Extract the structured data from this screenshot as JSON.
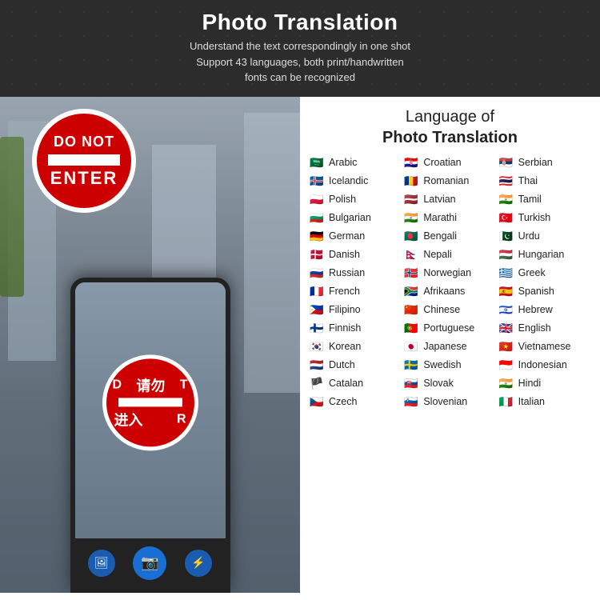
{
  "header": {
    "title": "Photo Translation",
    "subtitle1": "Understand the text correspondingly in one shot",
    "subtitle2": "Support 43 languages, both print/handwritten",
    "subtitle3": "fonts can be recognized"
  },
  "right_panel": {
    "title_line1": "Language of",
    "title_line2": "Photo Translation"
  },
  "languages": [
    {
      "name": "Arabic",
      "flag": "🇸🇦"
    },
    {
      "name": "Croatian",
      "flag": "🇭🇷"
    },
    {
      "name": "Serbian",
      "flag": "🇷🇸"
    },
    {
      "name": "Icelandic",
      "flag": "🇮🇸"
    },
    {
      "name": "Romanian",
      "flag": "🇷🇴"
    },
    {
      "name": "Thai",
      "flag": "🇹🇭"
    },
    {
      "name": "Polish",
      "flag": "🇵🇱"
    },
    {
      "name": "Latvian",
      "flag": "🇱🇻"
    },
    {
      "name": "Tamil",
      "flag": "🇮🇳"
    },
    {
      "name": "Bulgarian",
      "flag": "🇧🇬"
    },
    {
      "name": "Marathi",
      "flag": "🇮🇳"
    },
    {
      "name": "Turkish",
      "flag": "🇹🇷"
    },
    {
      "name": "German",
      "flag": "🇩🇪"
    },
    {
      "name": "Bengali",
      "flag": "🇧🇩"
    },
    {
      "name": "Urdu",
      "flag": "🇵🇰"
    },
    {
      "name": "Danish",
      "flag": "🇩🇰"
    },
    {
      "name": "Nepali",
      "flag": "🇳🇵"
    },
    {
      "name": "Hungarian",
      "flag": "🇭🇺"
    },
    {
      "name": "Russian",
      "flag": "🇷🇺"
    },
    {
      "name": "Norwegian",
      "flag": "🇳🇴"
    },
    {
      "name": "Greek",
      "flag": "🇬🇷"
    },
    {
      "name": "French",
      "flag": "🇫🇷"
    },
    {
      "name": "Afrikaans",
      "flag": "🇿🇦"
    },
    {
      "name": "Spanish",
      "flag": "🇪🇸"
    },
    {
      "name": "Filipino",
      "flag": "🇵🇭"
    },
    {
      "name": "Chinese",
      "flag": "🇨🇳"
    },
    {
      "name": "Hebrew",
      "flag": "🇮🇱"
    },
    {
      "name": "Finnish",
      "flag": "🇫🇮"
    },
    {
      "name": "Portuguese",
      "flag": "🇵🇹"
    },
    {
      "name": "English",
      "flag": "🇬🇧"
    },
    {
      "name": "Korean",
      "flag": "🇰🇷"
    },
    {
      "name": "Japanese",
      "flag": "🇯🇵"
    },
    {
      "name": "Vietnamese",
      "flag": "🇻🇳"
    },
    {
      "name": "Dutch",
      "flag": "🇳🇱"
    },
    {
      "name": "Swedish",
      "flag": "🇸🇪"
    },
    {
      "name": "Indonesian",
      "flag": "🇮🇩"
    },
    {
      "name": "Catalan",
      "flag": "🏴"
    },
    {
      "name": "Slovak",
      "flag": "🇸🇰"
    },
    {
      "name": "Hindi",
      "flag": "🇮🇳"
    },
    {
      "name": "Czech",
      "flag": "🇨🇿"
    },
    {
      "name": "Slovenian",
      "flag": "🇸🇮"
    },
    {
      "name": "Italian",
      "flag": "🇮🇹"
    }
  ],
  "phone": {
    "chinese_text1": "请勿",
    "chinese_text2": "进入",
    "ar_left": "D",
    "ar_right": "T",
    "ar_left2": "进",
    "ar_right2": "R"
  },
  "controls": {
    "gallery": "🖼",
    "camera": "📷",
    "lightning": "⚡"
  }
}
